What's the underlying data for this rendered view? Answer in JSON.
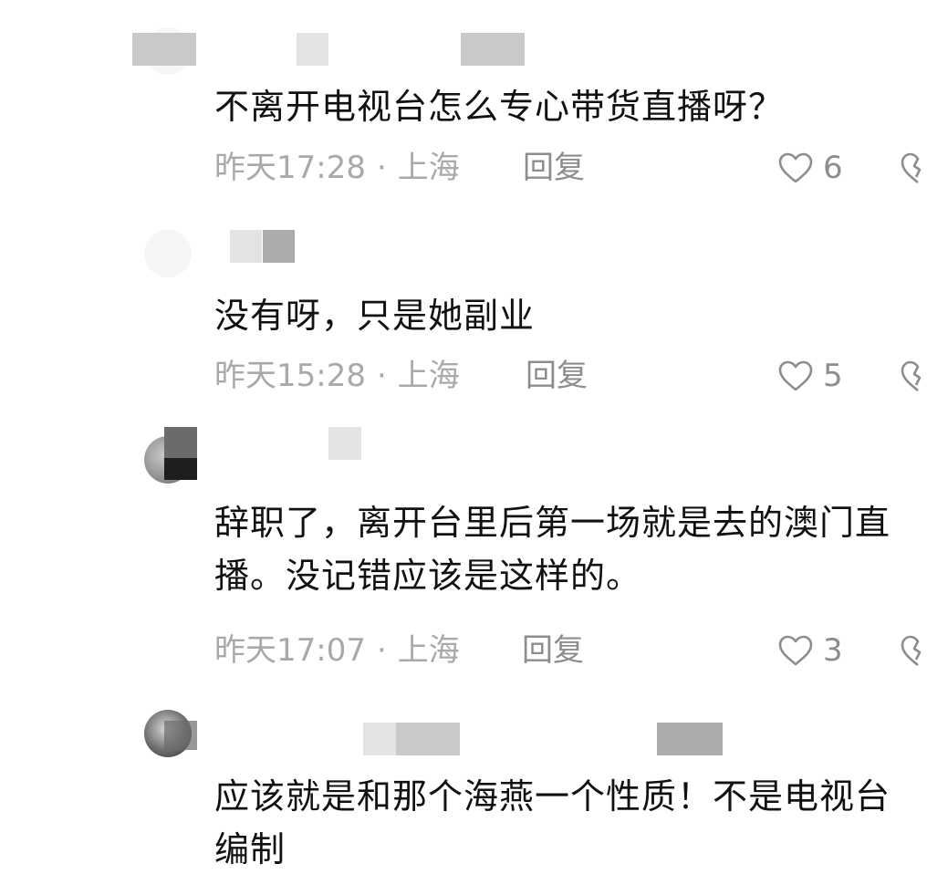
{
  "comments": [
    {
      "author": "",
      "text": "不离开电视台怎么专心带货直播呀？",
      "time": "昨天17:28",
      "location": "上海",
      "reply_label": "回复",
      "likes": "6"
    },
    {
      "author": "",
      "text": "没有呀，只是她副业",
      "time": "昨天15:28",
      "location": "上海",
      "reply_label": "回复",
      "likes": "5"
    },
    {
      "author": "",
      "text": "辞职了，离开台里后第一场就是去的澳门直播。没记错应该是这样的。",
      "time": "昨天17:07",
      "location": "上海",
      "reply_label": "回复",
      "likes": "3"
    },
    {
      "author": "",
      "text": "应该就是和那个海燕一个性质！不是电视台编制",
      "time": "",
      "location": "",
      "reply_label": "",
      "likes": ""
    }
  ],
  "separator": "·",
  "icons": {
    "like": "heart-outline-icon",
    "dislike": "broken-heart-icon"
  },
  "colors": {
    "text": "#111111",
    "meta": "#a9a9a9",
    "action": "#8d8d8d",
    "background": "#ffffff"
  }
}
